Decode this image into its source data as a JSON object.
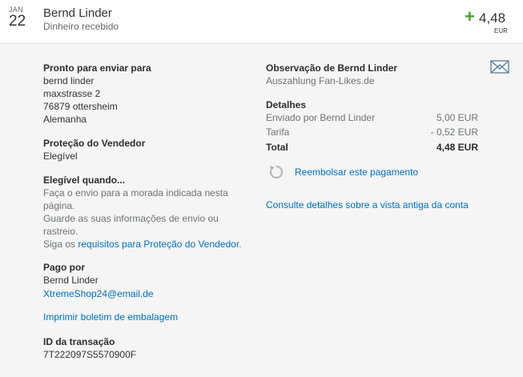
{
  "header": {
    "date_month": "JAN",
    "date_day": "22",
    "name": "Bernd Linder",
    "subtitle": "Dinheiro recebido",
    "amount_sign": "+",
    "amount": "4,48",
    "currency": "EUR"
  },
  "shipping": {
    "label": "Pronto para enviar para",
    "lines": [
      "bernd linder",
      "maxstrasse 2",
      "76879 ottersheim",
      "Alemanha"
    ]
  },
  "seller_protection": {
    "label": "Proteção do Vendedor",
    "value": "Elegível"
  },
  "eligible_when": {
    "label": "Elegível quando...",
    "lines": [
      "Faça o envio para a morada indicada nesta",
      "página.",
      "Guarde as suas informações de envio ou",
      "rastreio."
    ],
    "last_prefix": "Siga os ",
    "link": "requisitos para Proteção do Vendedor",
    "last_suffix": "."
  },
  "paid_by": {
    "label": "Pago por",
    "name": "Bernd Linder",
    "email": "XtremeShop24@email.de"
  },
  "print_link": "Imprimir boletim de embalagem",
  "transaction": {
    "label": "ID da transação",
    "id": "7T222097S5570900F"
  },
  "note": {
    "label": "Observação de Bernd Linder",
    "text": "Auszahlung Fan-Likes.de"
  },
  "details": {
    "label": "Detalhes",
    "rows": [
      {
        "label": "Enviado por Bernd Linder",
        "value": "5,00 EUR"
      },
      {
        "label": "Tarifa",
        "value": "- 0,52 EUR"
      }
    ],
    "total_label": "Total",
    "total_value": "4,48 EUR"
  },
  "refund_link": "Reembolsar este pagamento",
  "old_view_link": "Consulte detalhes sobre a vista antiga da conta",
  "icons": {
    "mail": "envelope-icon",
    "refund": "refresh-icon"
  },
  "colors": {
    "link": "#0070ba",
    "positive": "#4a9e2f"
  }
}
